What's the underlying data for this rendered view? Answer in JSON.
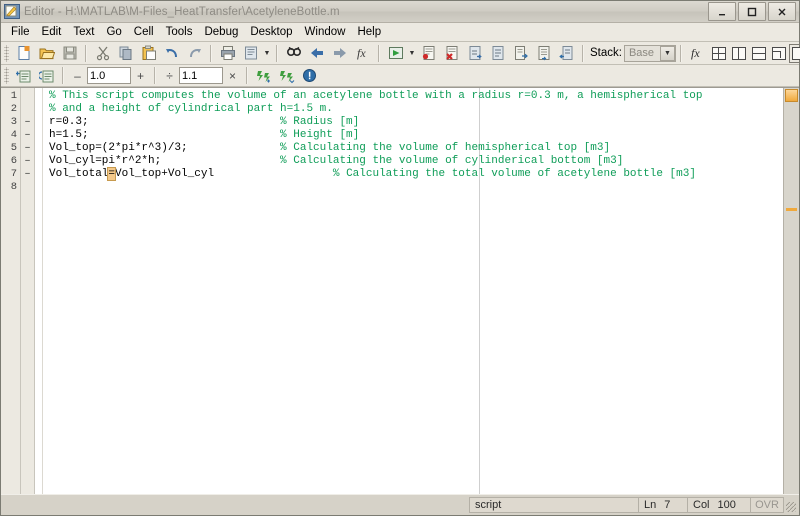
{
  "window": {
    "title": "Editor - H:\\MATLAB\\M-Files_HeatTransfer\\AcetyleneBottle.m",
    "icon": "matlab-editor-icon",
    "minimize_label": "_",
    "maximize_label": "□",
    "close_label": "✕"
  },
  "menubar": {
    "items": [
      {
        "label": "File"
      },
      {
        "label": "Edit"
      },
      {
        "label": "Text"
      },
      {
        "label": "Go"
      },
      {
        "label": "Cell"
      },
      {
        "label": "Tools"
      },
      {
        "label": "Debug"
      },
      {
        "label": "Desktop"
      },
      {
        "label": "Window"
      },
      {
        "label": "Help"
      }
    ]
  },
  "toolbar": {
    "buttons": [
      {
        "name": "new-file-icon",
        "tip": "New"
      },
      {
        "name": "open-file-icon",
        "tip": "Open"
      },
      {
        "name": "save-icon",
        "tip": "Save"
      },
      {
        "name": "cut-icon",
        "tip": "Cut"
      },
      {
        "name": "copy-icon",
        "tip": "Copy"
      },
      {
        "name": "paste-icon",
        "tip": "Paste"
      },
      {
        "name": "undo-icon",
        "tip": "Undo"
      },
      {
        "name": "redo-icon",
        "tip": "Redo"
      },
      {
        "name": "print-icon",
        "tip": "Print"
      },
      {
        "name": "print-preview-icon",
        "tip": "Print Preview"
      },
      {
        "name": "find-icon",
        "tip": "Find"
      },
      {
        "name": "back-icon",
        "tip": "Back"
      },
      {
        "name": "forward-icon",
        "tip": "Forward"
      },
      {
        "name": "function-browser-icon",
        "tip": "Function Browser"
      },
      {
        "name": "run-icon",
        "tip": "Run"
      },
      {
        "name": "set-breakpoint-icon",
        "tip": "Set/Clear Breakpoint"
      },
      {
        "name": "clear-breakpoints-icon",
        "tip": "Clear All Breakpoints"
      },
      {
        "name": "step-icon",
        "tip": "Step"
      },
      {
        "name": "step-in-icon",
        "tip": "Step In"
      },
      {
        "name": "step-out-icon",
        "tip": "Step Out"
      },
      {
        "name": "continue-icon",
        "tip": "Continue"
      },
      {
        "name": "exit-debug-icon",
        "tip": "Exit Debug Mode"
      }
    ],
    "stack_label": "Stack:",
    "stack_value": "Base",
    "fx_label": "fx",
    "dock_layouts": [
      {
        "name": "tile-4-icon"
      },
      {
        "name": "tile-2-vertical-icon"
      },
      {
        "name": "tile-2-horizontal-icon"
      },
      {
        "name": "float-icon"
      },
      {
        "name": "maximize-layout-icon"
      }
    ]
  },
  "cell_toolbar": {
    "buttons": [
      {
        "name": "insert-cell-divider-icon",
        "tip": "Insert Cell Divider"
      },
      {
        "name": "insert-cell-divider-selection-icon",
        "tip": "Insert Cell Divider Around Selection"
      },
      {
        "name": "evaluate-cell-icon",
        "tip": "Evaluate Cell"
      },
      {
        "name": "evaluate-cell-advance-icon",
        "tip": "Evaluate Cell and Advance"
      },
      {
        "name": "cell-help-icon",
        "tip": "Cell Mode Help"
      }
    ],
    "minus_label": "–",
    "value_subtract": "1.0",
    "plus_label": "+",
    "divide_label": "÷",
    "value_divide": "1.1",
    "multiply_label": "×"
  },
  "editor": {
    "line_numbers": [
      "1",
      "2",
      "3",
      "4",
      "5",
      "6",
      "7",
      "8"
    ],
    "breakpoint_marks": [
      "",
      "",
      "–",
      "–",
      "–",
      "–",
      "–",
      ""
    ],
    "lines": [
      {
        "n": 1,
        "segments": [
          {
            "type": "comment",
            "text": "% This script computes the volume of an acetylene bottle with a radius r=0.3 m, a hemispherical top"
          }
        ]
      },
      {
        "n": 2,
        "segments": [
          {
            "type": "comment",
            "text": "% and a height of cylindrical part h=1.5 m."
          }
        ]
      },
      {
        "n": 3,
        "segments": [
          {
            "type": "code",
            "text": "r=0.3;                             "
          },
          {
            "type": "comment",
            "text": "% Radius [m]"
          }
        ]
      },
      {
        "n": 4,
        "segments": [
          {
            "type": "code",
            "text": "h=1.5;                             "
          },
          {
            "type": "comment",
            "text": "% Height [m]"
          }
        ]
      },
      {
        "n": 5,
        "segments": [
          {
            "type": "code",
            "text": "Vol_top=(2*pi*r^3)/3;              "
          },
          {
            "type": "comment",
            "text": "% Calculating the volume of hemispherical top [m3]"
          }
        ]
      },
      {
        "n": 6,
        "segments": [
          {
            "type": "code",
            "text": "Vol_cyl=pi*r^2*h;                  "
          },
          {
            "type": "comment",
            "text": "% Calculating the volume of cylinderical bottom [m3]"
          }
        ]
      },
      {
        "n": 7,
        "segments": [
          {
            "type": "code",
            "text": "Vol_total"
          },
          {
            "type": "match",
            "text": "="
          },
          {
            "type": "code",
            "text": "Vol_top+Vol_cyl                  "
          },
          {
            "type": "comment",
            "text": "% Calculating the total volume of acetylene bottle [m3]"
          }
        ]
      },
      {
        "n": 8,
        "segments": []
      }
    ],
    "colors": {
      "comment": "#0f9d58",
      "code": "#000000",
      "match_highlight": "#f4c98a",
      "background": "#ffffff",
      "gutter": "#ece9e1",
      "margin_line": "#cfcfcf"
    }
  },
  "statusbar": {
    "file_type": "script",
    "line_label": "Ln",
    "line_value": "7",
    "col_label": "Col",
    "col_value": "100",
    "overwrite_label": "OVR"
  }
}
